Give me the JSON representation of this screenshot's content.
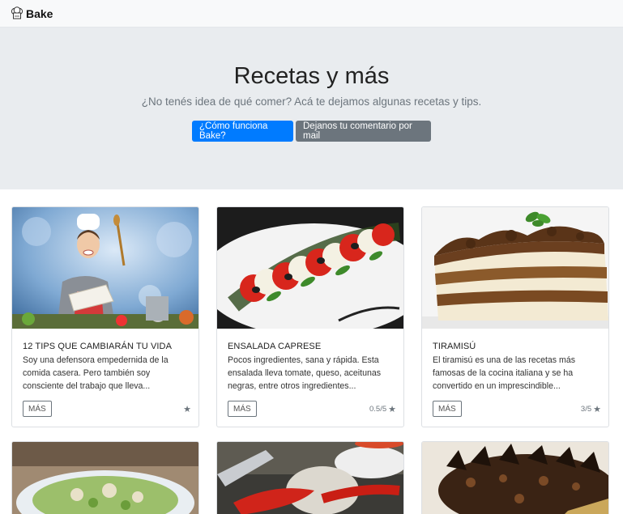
{
  "navbar": {
    "brand": "Bake",
    "brand_icon": "chef-hat-icon"
  },
  "hero": {
    "title": "Recetas y más",
    "subtitle": "¿No tenés idea de qué comer? Acá te dejamos algunas recetas y tips.",
    "primary_button": "¿Cómo funciona Bake?",
    "secondary_button": "Dejanos tu comentario por mail"
  },
  "cards": [
    {
      "title": "12 TIPS QUE CAMBIARÁN TU VIDA",
      "text": "Soy una defensora empedernida de la comida casera. Pero también soy consciente del trabajo que lleva...",
      "button": "MÁS",
      "rating": ""
    },
    {
      "title": "ENSALADA CAPRESE",
      "text": "Pocos ingredientes, sana y rápida. Esta ensalada lleva tomate, queso, aceitunas negras, entre otros ingredientes...",
      "button": "MÁS",
      "rating": "0.5/5"
    },
    {
      "title": "TIRAMISÚ",
      "text": "El tiramisú es una de las recetas más famosas de la cocina italiana y se ha convertido en un imprescindible...",
      "button": "MÁS",
      "rating": "3/5"
    }
  ],
  "colors": {
    "primary": "#007bff",
    "secondary": "#6c757d",
    "hero_bg": "#e9ecef"
  }
}
